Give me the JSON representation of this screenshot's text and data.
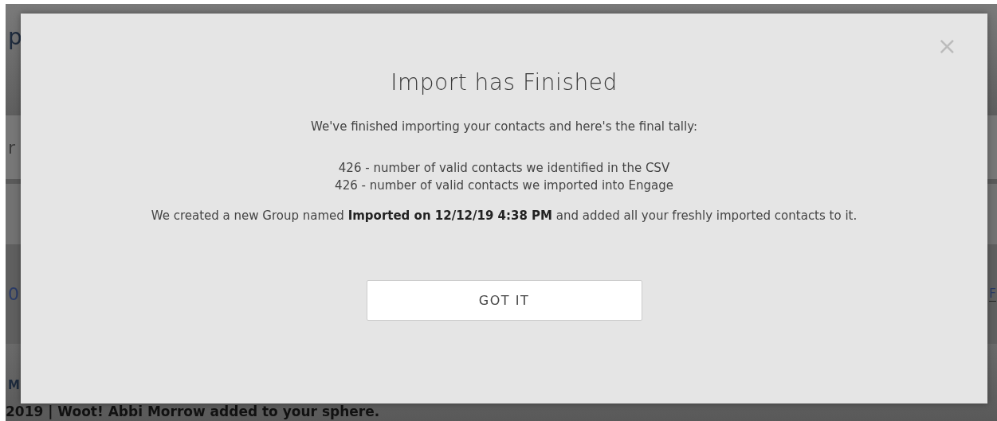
{
  "background": {
    "heading": "p",
    "field_text": "r",
    "link_text": "0",
    "right_link": "F",
    "name_fragment": "M",
    "activity": "2019 | Woot! Abbi Morrow added to your sphere."
  },
  "dialog": {
    "close": "×",
    "title": "Import has Finished",
    "intro": "We've finished importing your contacts and here's the final tally:",
    "tally": [
      "426 - number of valid contacts we identified in the CSV",
      "426 - number of valid contacts we imported into Engage"
    ],
    "message": "We created a new Group named **Imported on 12/12/19 4:38 PM** and added all your freshly imported contacts to it.",
    "button": "GOT IT"
  }
}
